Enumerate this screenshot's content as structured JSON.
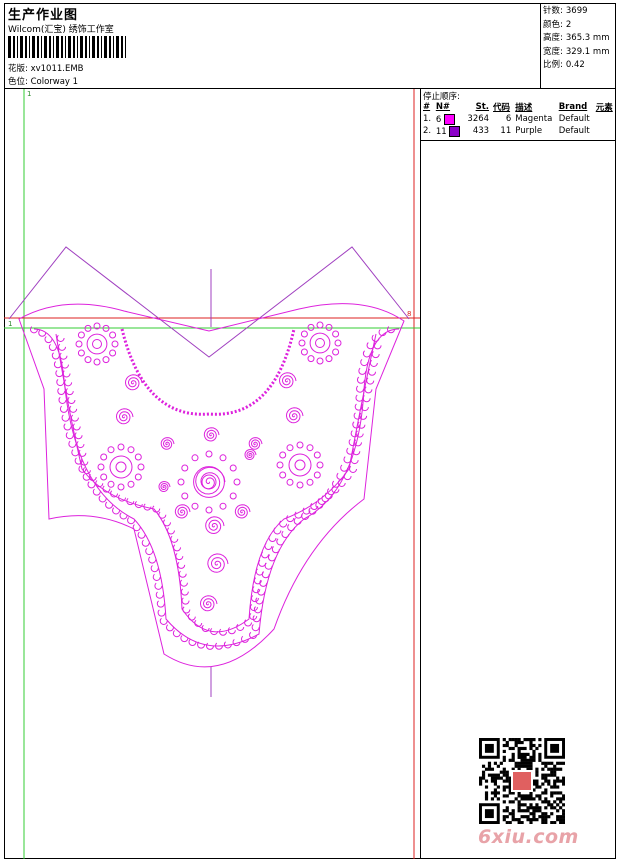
{
  "header": {
    "title": "生产作业图",
    "studio": "Wilcom(汇宝) 绣饰工作室",
    "design_label": "花版:",
    "design_value": "xv1011.EMB",
    "colorway_label": "色位:",
    "colorway_value": "Colorway 1"
  },
  "stats": [
    {
      "label": "针数:",
      "value": "3699"
    },
    {
      "label": "颜色:",
      "value": "2"
    },
    {
      "label": "高度:",
      "value": "365.3 mm"
    },
    {
      "label": "宽度:",
      "value": "329.1 mm"
    },
    {
      "label": "比例:",
      "value": "0.42"
    }
  ],
  "stop_sequence": {
    "title": "停止顺序:",
    "columns": [
      "#",
      "N#",
      "St.",
      "代码",
      "描述",
      "Brand",
      "元素"
    ],
    "rows": [
      {
        "index": "1.",
        "needle": "6",
        "color": "#ff00ff",
        "stitches": "3264",
        "code": "6",
        "desc": "Magenta",
        "brand": "Default",
        "element": ""
      },
      {
        "index": "2.",
        "needle": "11",
        "color": "#8b00c8",
        "stitches": "433",
        "code": "11",
        "desc": "Purple",
        "brand": "Default",
        "element": ""
      }
    ]
  },
  "guides": {
    "mark_top": "1",
    "mark_left": "1",
    "mark_right": "8"
  },
  "watermark": "6xiu.com",
  "colors": {
    "magenta": "#dd22dd",
    "purple": "#8b00c8",
    "guide_green": "#33cc33",
    "guide_red": "#dd2222"
  }
}
